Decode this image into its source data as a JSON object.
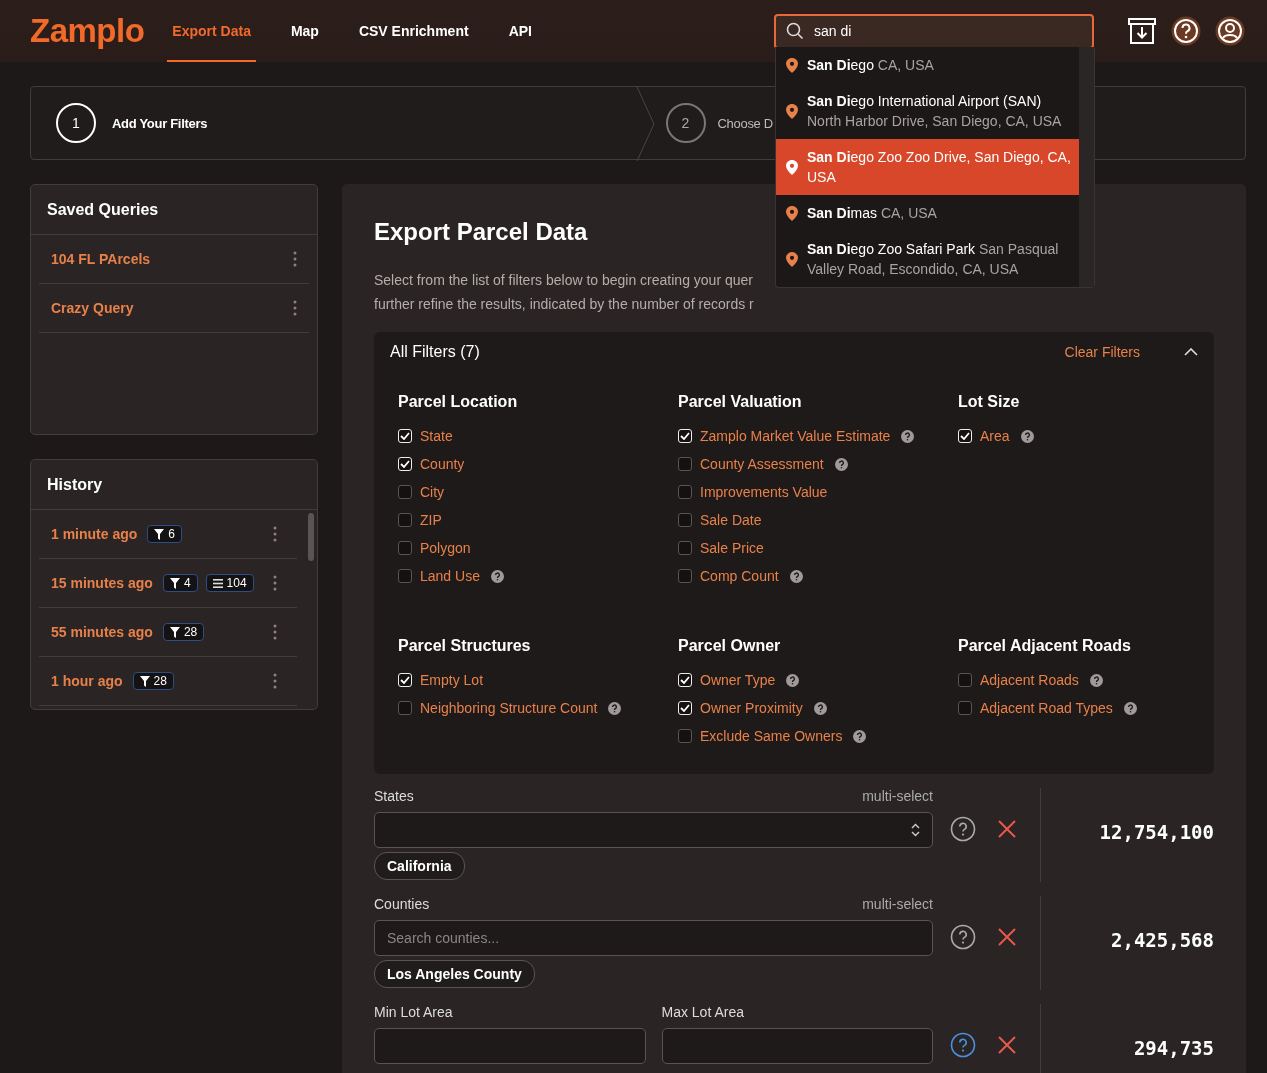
{
  "app": {
    "logo": "Zamplo"
  },
  "nav": [
    {
      "label": "Export Data",
      "selected": true
    },
    {
      "label": "Map",
      "selected": false
    },
    {
      "label": "CSV Enrichment",
      "selected": false
    },
    {
      "label": "API",
      "selected": false
    }
  ],
  "search": {
    "value": "san di",
    "suggestions": [
      {
        "name": "**San Di**ego",
        "detail": "CA, USA",
        "selected": false
      },
      {
        "name": "**San Di**ego International Airport (SAN)",
        "detail": "North Harbor Drive, San Diego, CA, USA",
        "selected": false
      },
      {
        "name": "**San Di**ego Zoo",
        "detail": "Zoo Drive, San Diego, CA, USA",
        "selected": true
      },
      {
        "name": "**San Di**mas",
        "detail": "CA, USA",
        "selected": false
      },
      {
        "name": "**San Di**ego Zoo Safari Park",
        "detail": "San Pasqual Valley Road, Escondido, CA, USA",
        "selected": false
      }
    ]
  },
  "steps": [
    {
      "number": "1",
      "label": "Add Your Filters",
      "active": true
    },
    {
      "number": "2",
      "label": "Choose D",
      "active": false
    }
  ],
  "saved_queries": {
    "title": "Saved Queries",
    "items": [
      "104 FL PArcels",
      "Crazy Query"
    ]
  },
  "history": {
    "title": "History",
    "items": [
      {
        "time": "1 minute ago",
        "badges": [
          {
            "kind": "filters",
            "count": "6"
          }
        ]
      },
      {
        "time": "15 minutes ago",
        "badges": [
          {
            "kind": "filters",
            "count": "4"
          },
          {
            "kind": "records",
            "count": "104"
          }
        ]
      },
      {
        "time": "55 minutes ago",
        "badges": [
          {
            "kind": "filters",
            "count": "28"
          }
        ]
      },
      {
        "time": "1 hour ago",
        "badges": [
          {
            "kind": "filters",
            "count": "28"
          }
        ]
      }
    ]
  },
  "export": {
    "title": "Export Parcel Data",
    "description": [
      "Select from the list of filters below to begin creating your quer",
      "further refine the results, indicated by the number of records r"
    ],
    "all_filters": {
      "title": "All Filters (7)",
      "clear": "Clear Filters",
      "expanded": true,
      "groups": [
        {
          "title": "Parcel Location",
          "options": [
            {
              "label": "State",
              "checked": true,
              "help": false
            },
            {
              "label": "County",
              "checked": true,
              "help": false
            },
            {
              "label": "City",
              "checked": false,
              "help": false
            },
            {
              "label": "ZIP",
              "checked": false,
              "help": false
            },
            {
              "label": "Polygon",
              "checked": false,
              "help": false
            },
            {
              "label": "Land Use",
              "checked": false,
              "help": true
            }
          ]
        },
        {
          "title": "Parcel Valuation",
          "options": [
            {
              "label": "Zamplo Market Value Estimate",
              "checked": true,
              "help": true
            },
            {
              "label": "County Assessment",
              "checked": false,
              "help": true
            },
            {
              "label": "Improvements Value",
              "checked": false,
              "help": false
            },
            {
              "label": "Sale Date",
              "checked": false,
              "help": false
            },
            {
              "label": "Sale Price",
              "checked": false,
              "help": false
            },
            {
              "label": "Comp Count",
              "checked": false,
              "help": true
            }
          ]
        },
        {
          "title": "Lot Size",
          "options": [
            {
              "label": "Area",
              "checked": true,
              "help": true
            }
          ]
        },
        {
          "title": "Parcel Structures",
          "options": [
            {
              "label": "Empty Lot",
              "checked": true,
              "help": false
            },
            {
              "label": "Neighboring Structure Count",
              "checked": false,
              "help": true
            }
          ]
        },
        {
          "title": "Parcel Owner",
          "options": [
            {
              "label": "Owner Type",
              "checked": true,
              "help": true
            },
            {
              "label": "Owner Proximity",
              "checked": true,
              "help": true
            },
            {
              "label": "Exclude Same Owners",
              "checked": false,
              "help": true
            }
          ]
        },
        {
          "title": "Parcel Adjacent Roads",
          "options": [
            {
              "label": "Adjacent Roads",
              "checked": false,
              "help": true
            },
            {
              "label": "Adjacent Road Types",
              "checked": false,
              "help": true
            }
          ]
        }
      ]
    },
    "filters": [
      {
        "kind": "select",
        "label": "States",
        "hint": "multi-select",
        "chips": [
          "California"
        ],
        "count": "12,754,100",
        "help_active": false
      },
      {
        "kind": "search",
        "label": "Counties",
        "hint": "multi-select",
        "placeholder": "Search counties...",
        "chips": [
          "Los Angeles County"
        ],
        "count": "2,425,568",
        "help_active": false
      },
      {
        "kind": "range",
        "fields": [
          {
            "label": "Min Lot Area"
          },
          {
            "label": "Max Lot Area"
          }
        ],
        "count": "294,735",
        "help_active": true
      }
    ]
  }
}
